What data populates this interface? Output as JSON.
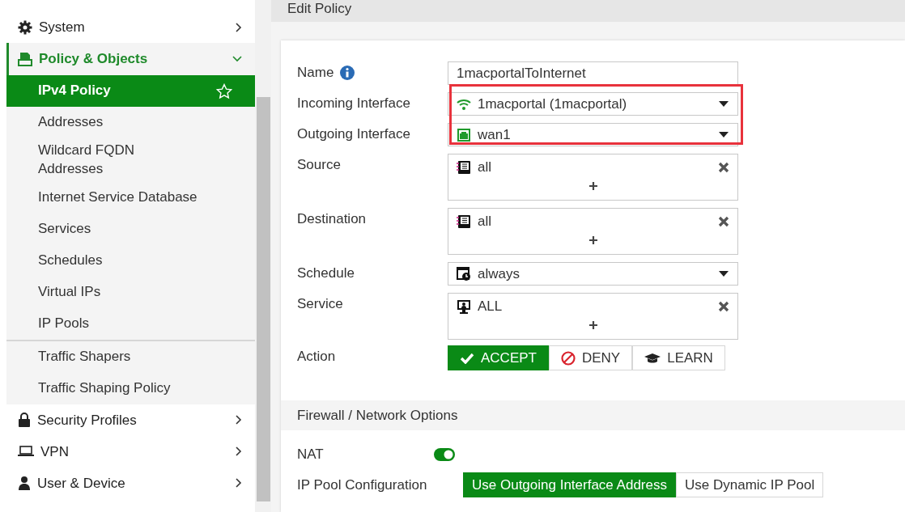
{
  "sidebar": {
    "items": [
      {
        "label": "System",
        "expanded": false
      },
      {
        "label": "Policy & Objects",
        "expanded": true,
        "sections": [
          {
            "items": [
              {
                "label": "IPv4 Policy",
                "selected": true
              },
              {
                "label": "Addresses",
                "selected": false
              },
              {
                "label": "Wildcard FQDN Addresses",
                "selected": false
              },
              {
                "label": "Internet Service Database",
                "selected": false
              },
              {
                "label": "Services",
                "selected": false
              },
              {
                "label": "Schedules",
                "selected": false
              },
              {
                "label": "Virtual IPs",
                "selected": false
              },
              {
                "label": "IP Pools",
                "selected": false
              }
            ]
          },
          {
            "items": [
              {
                "label": "Traffic Shapers",
                "selected": false
              },
              {
                "label": "Traffic Shaping Policy",
                "selected": false
              }
            ]
          }
        ]
      },
      {
        "label": "Security Profiles",
        "expanded": false
      },
      {
        "label": "VPN",
        "expanded": false
      },
      {
        "label": "User & Device",
        "expanded": false
      }
    ]
  },
  "page": {
    "title": "Edit Policy"
  },
  "form": {
    "fields": [
      {
        "label": "Name",
        "kind": "text",
        "value": "1macportalToInternet",
        "highlighted": false
      },
      {
        "label": "Incoming Interface",
        "kind": "select",
        "value": "1macportal (1macportal)",
        "highlighted": true
      },
      {
        "label": "Outgoing Interface",
        "kind": "select",
        "value": "wan1",
        "highlighted": true
      },
      {
        "label": "Source",
        "kind": "multi",
        "entries": [
          "all"
        ],
        "highlighted": false
      },
      {
        "label": "Destination",
        "kind": "multi",
        "entries": [
          "all"
        ],
        "highlighted": false
      },
      {
        "label": "Schedule",
        "kind": "select",
        "value": "always",
        "highlighted": false
      },
      {
        "label": "Service",
        "kind": "multi",
        "entries": [
          "ALL"
        ],
        "highlighted": false
      },
      {
        "label": "Action",
        "kind": "actions",
        "options": [
          {
            "label": "ACCEPT",
            "selected": true
          },
          {
            "label": "DENY",
            "selected": false
          },
          {
            "label": "LEARN",
            "selected": false
          }
        ],
        "highlighted": false
      }
    ]
  },
  "firewall_section": {
    "title": "Firewall / Network Options",
    "nat": {
      "label": "NAT",
      "on": true
    },
    "ip_pool": {
      "label": "IP Pool Configuration",
      "options": [
        {
          "label": "Use Outgoing Interface Address",
          "selected": true
        },
        {
          "label": "Use Dynamic IP Pool",
          "selected": false
        }
      ]
    }
  }
}
